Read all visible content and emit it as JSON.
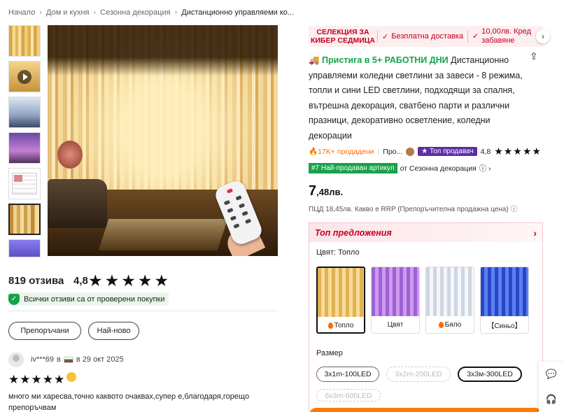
{
  "breadcrumb": [
    "Начало",
    "Дом и кухня",
    "Сезонна декорация",
    "Дистанционно управляеми ко..."
  ],
  "reviews": {
    "count": "819 отзива",
    "rating": "4,8",
    "stars": "★★★★★",
    "verified": "Всички отзиви са от проверени покупки",
    "filter_recommended": "Препоръчани",
    "filter_newest": "Най-ново",
    "first": {
      "user": "iv***69",
      "in": "в",
      "date": "в 29 окт 2025",
      "stars": "★★★★★",
      "text": "много ми харесва,точно каквото очаквах,супер е,благодаря,горещо препоръчвам"
    }
  },
  "promo": {
    "selection": "СЕЛЕКЦИЯ ЗА КИБЕР СЕДМИЦА",
    "free_shipping": "Безплатна доставка",
    "credit": "10,00лв. Кред забавяне"
  },
  "product": {
    "shipping": "Пристига в 5+ РАБОТНИ ДНИ",
    "title": "Дистанционно управляеми коледни светлини за завеси - 8 режима, топли и сини LED светлини, подходящи за спалня, вътрешна декорация, сватбено парти и различни празници, декоративно осветление, коледни декорации",
    "sold": "17K+ продадени",
    "store_prefix": "Про...",
    "top_seller": "Топ продавач",
    "rating": "4,8",
    "stars": "★★★★★",
    "best_tag": "#7 Най-продаван артикул",
    "best_category": "от Сезонна декорация",
    "price_int": "7",
    "price_dec": ",48лв.",
    "rrp": "ПЦД 18,45лв. Какво е RRP (Препоръчителна продажна цена)"
  },
  "offers": {
    "title": "Топ предложения",
    "color_label": "Цвят: Топло",
    "colors": [
      "Топло",
      "Цвят",
      "Бяло",
      "【Синьо】"
    ],
    "size_label": "Размер",
    "sizes": [
      "3x1m-100LED",
      "3x2m-200LED",
      "3x3м-300LED",
      "6x3m-600LED"
    ]
  },
  "icons": {
    "promo_check": "check-icon",
    "share": "share-icon",
    "chat": "chat-icon",
    "headset": "support-icon"
  },
  "colors": {
    "accent_red": "#c20022",
    "green": "#16a34a",
    "orange": "#fe6a00",
    "purple": "#5b2ea6"
  }
}
